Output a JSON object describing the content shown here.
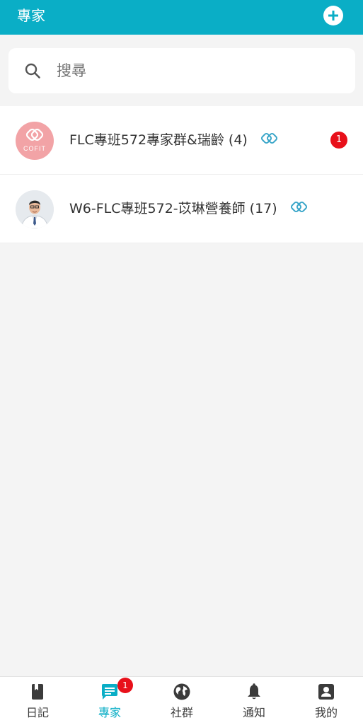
{
  "header": {
    "title": "專家",
    "add_icon": "plus-circle-icon"
  },
  "search": {
    "placeholder": "搜尋",
    "icon": "search-icon"
  },
  "conversations": [
    {
      "name": "FLC專班572專家群&瑞齡 (4)",
      "avatar": "cofit-logo",
      "avatar_text": "COFIT",
      "tag_icon": "cofit-link-icon",
      "unread": "1"
    },
    {
      "name": "W6-FLC專班572-苡琳營養師 (17)",
      "avatar": "expert-photo",
      "tag_icon": "cofit-link-icon"
    }
  ],
  "bottom_nav": {
    "items": [
      {
        "label": "日記",
        "icon": "diary-book-icon"
      },
      {
        "label": "專家",
        "icon": "chat-icon",
        "badge": "1",
        "active": true
      },
      {
        "label": "社群",
        "icon": "globe-icon"
      },
      {
        "label": "通知",
        "icon": "bell-icon"
      },
      {
        "label": "我的",
        "icon": "profile-icon"
      }
    ]
  },
  "colors": {
    "primary": "#0aaec6",
    "badge": "#e8101a",
    "avatar_pink": "#f2a3a6"
  }
}
